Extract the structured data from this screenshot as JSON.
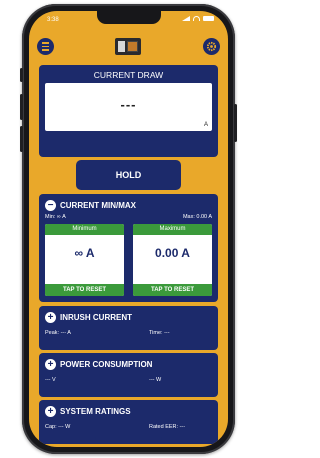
{
  "status": {
    "time": "3:38"
  },
  "topbar": {
    "menu_icon": "hamburger-icon",
    "logo_icon": "brand-logo",
    "settings_icon": "gear-icon"
  },
  "current_draw": {
    "title": "CURRENT DRAW",
    "value": "---",
    "unit": "A"
  },
  "hold": {
    "label": "HOLD"
  },
  "min_max": {
    "title": "CURRENT MIN/MAX",
    "min_line": "Min: ∞ A",
    "max_line": "Max: 0.00 A",
    "minimum": {
      "header": "Minimum",
      "value": "∞ A",
      "reset": "TAP TO RESET"
    },
    "maximum": {
      "header": "Maximum",
      "value": "0.00 A",
      "reset": "TAP TO RESET"
    }
  },
  "inrush": {
    "title": "INRUSH CURRENT",
    "left": "Peak: --- A",
    "right": "Time: ---"
  },
  "power": {
    "title": "POWER CONSUMPTION",
    "left": "--- V",
    "right": "--- W"
  },
  "ratings": {
    "title": "SYSTEM RATINGS",
    "left": "Cap: --- W",
    "right": "Rated EER: ---"
  },
  "colors": {
    "background": "#e9a82a",
    "panel": "#1c2a6b",
    "accent_green": "#3b9a3b",
    "frame": "#17171a"
  }
}
